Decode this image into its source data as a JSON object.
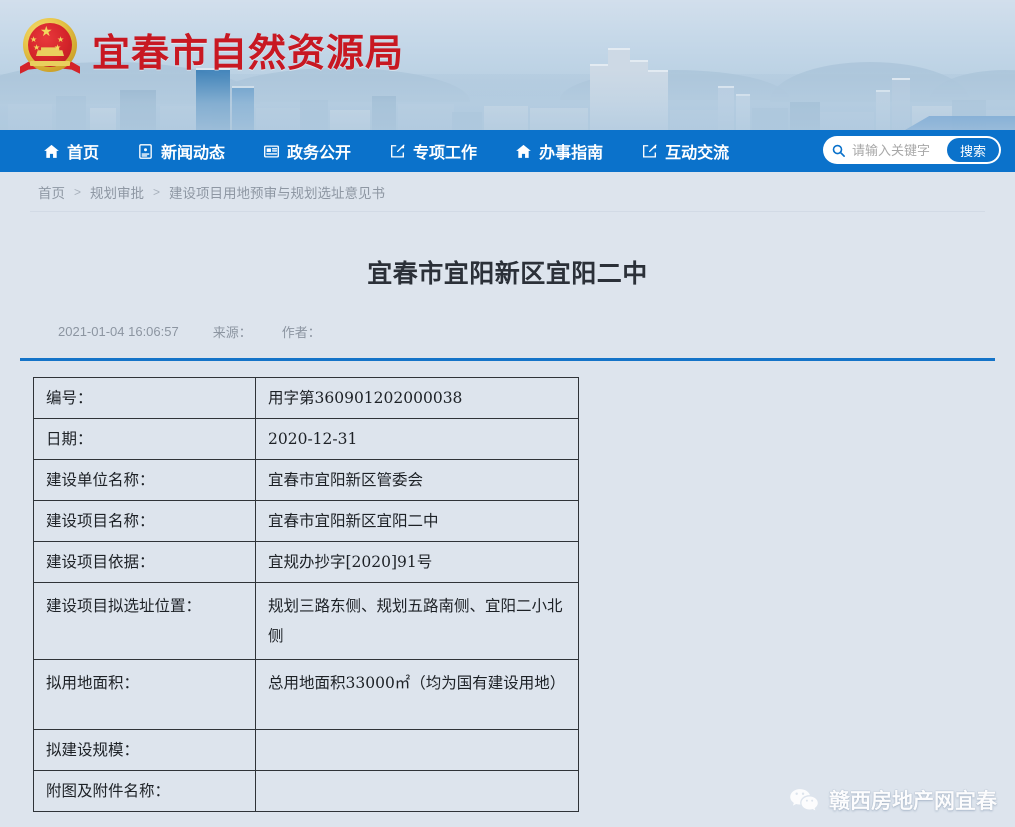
{
  "site": {
    "emblem_icon": "china-national-emblem-icon",
    "title": "宜春市自然资源局"
  },
  "nav": {
    "items": [
      {
        "label": "首页",
        "icon": "home-icon"
      },
      {
        "label": "新闻动态",
        "icon": "document-icon"
      },
      {
        "label": "政务公开",
        "icon": "news-list-icon"
      },
      {
        "label": "专项工作",
        "icon": "edit-square-icon"
      },
      {
        "label": "办事指南",
        "icon": "home-icon"
      },
      {
        "label": "互动交流",
        "icon": "edit-square-icon"
      }
    ],
    "search": {
      "icon": "search-icon",
      "placeholder": "请输入关键字",
      "value": "",
      "button_label": "搜索"
    }
  },
  "breadcrumb": {
    "separator": ">",
    "items": [
      {
        "label": "首页"
      },
      {
        "label": "规划审批"
      },
      {
        "label": "建设项目用地预审与规划选址意见书"
      }
    ]
  },
  "article": {
    "title": "宜春市宜阳新区宜阳二中",
    "timestamp": "2021-01-04 16:06:57",
    "source_label": "来源：",
    "source_value": "",
    "author_label": "作者：",
    "author_value": ""
  },
  "table": {
    "rows": [
      {
        "key": "编号：",
        "value": "用字第360901202000038"
      },
      {
        "key": "日期：",
        "value": "2020-12-31"
      },
      {
        "key": "建设单位名称：",
        "value": "宜春市宜阳新区管委会"
      },
      {
        "key": "建设项目名称：",
        "value": "宜春市宜阳新区宜阳二中"
      },
      {
        "key": "建设项目依据：",
        "value": "宜规办抄字[2020]91号"
      },
      {
        "key": "建设项目拟选址位置：",
        "value": "规划三路东侧、规划五路南侧、宜阳二小北侧"
      },
      {
        "key": "拟用地面积：",
        "value": "总用地面积33000㎡（均为国有建设用地）"
      },
      {
        "key": "拟建设规模：",
        "value": ""
      },
      {
        "key": "附图及附件名称：",
        "value": ""
      }
    ]
  },
  "watermark": {
    "icon": "wechat-icon",
    "text": "赣西房地产网宜春"
  },
  "colors": {
    "page_background": "#dde4ed",
    "nav_blue": "#0b72cb",
    "title_red": "#c81822",
    "rule_blue": "#1473c8",
    "table_border": "#2f3338"
  }
}
